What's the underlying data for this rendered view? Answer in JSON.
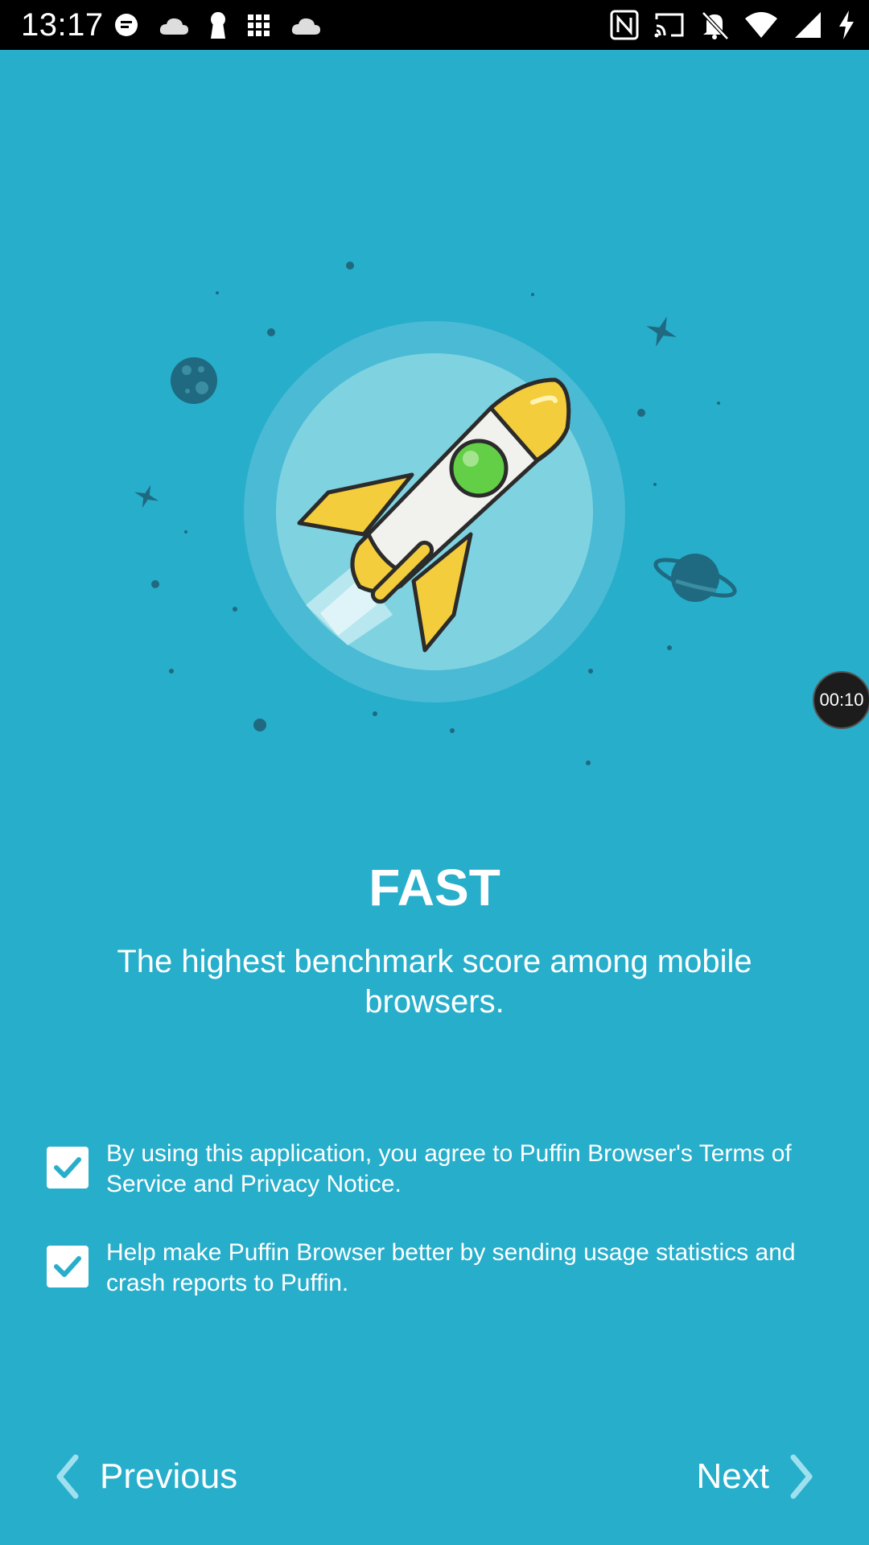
{
  "status_bar": {
    "time": "13:17",
    "left_icons": [
      "chat-bubble-icon",
      "cloud-icon",
      "keyhole-icon",
      "grid-icon",
      "cloud-icon"
    ],
    "right_icons": [
      "nfc-icon",
      "cast-icon",
      "bell-off-icon",
      "wifi-icon",
      "signal-icon",
      "charging-icon"
    ]
  },
  "onboarding": {
    "title": "FAST",
    "subtitle": "The highest benchmark score among mobile browsers."
  },
  "consents": [
    {
      "label": "By using this application, you agree to Puffin Browser's Terms of Service and Privacy Notice.",
      "checked": true
    },
    {
      "label": "Help make Puffin Browser better by sending usage statistics and crash reports to Puffin.",
      "checked": true
    }
  ],
  "navigation": {
    "previous_label": "Previous",
    "next_label": "Next"
  },
  "overlay": {
    "timer": "00:10"
  },
  "colors": {
    "background": "#27aecb",
    "rocket_body": "#f1f1ee",
    "rocket_fins": "#f3cd3b",
    "porthole": "#62cf46",
    "dark_accent": "#1f6a80"
  }
}
